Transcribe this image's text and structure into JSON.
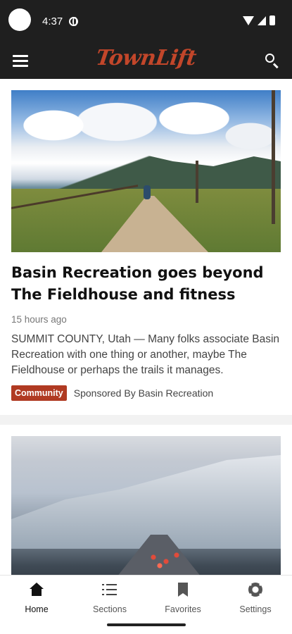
{
  "status_bar": {
    "time": "4:37"
  },
  "app_bar": {
    "logo": "TownLift"
  },
  "articles": [
    {
      "title": "Basin Recreation goes beyond The Fieldhouse and fitness",
      "time_ago": "15 hours ago",
      "excerpt": "SUMMIT COUNTY, Utah — Many folks associate Basin Recreation with one thing or another, maybe The Fieldhouse or perhaps the trails it manages.",
      "category": "Community",
      "sponsor": "Sponsored By Basin Recreation"
    }
  ],
  "bottom_nav": {
    "items": [
      {
        "label": "Home",
        "icon": "home-icon"
      },
      {
        "label": "Sections",
        "icon": "list-icon"
      },
      {
        "label": "Favorites",
        "icon": "bookmark-icon"
      },
      {
        "label": "Settings",
        "icon": "gear-icon"
      }
    ]
  },
  "colors": {
    "brand": "#c2462a",
    "badge": "#b03a22",
    "bar": "#1f1f1f"
  }
}
